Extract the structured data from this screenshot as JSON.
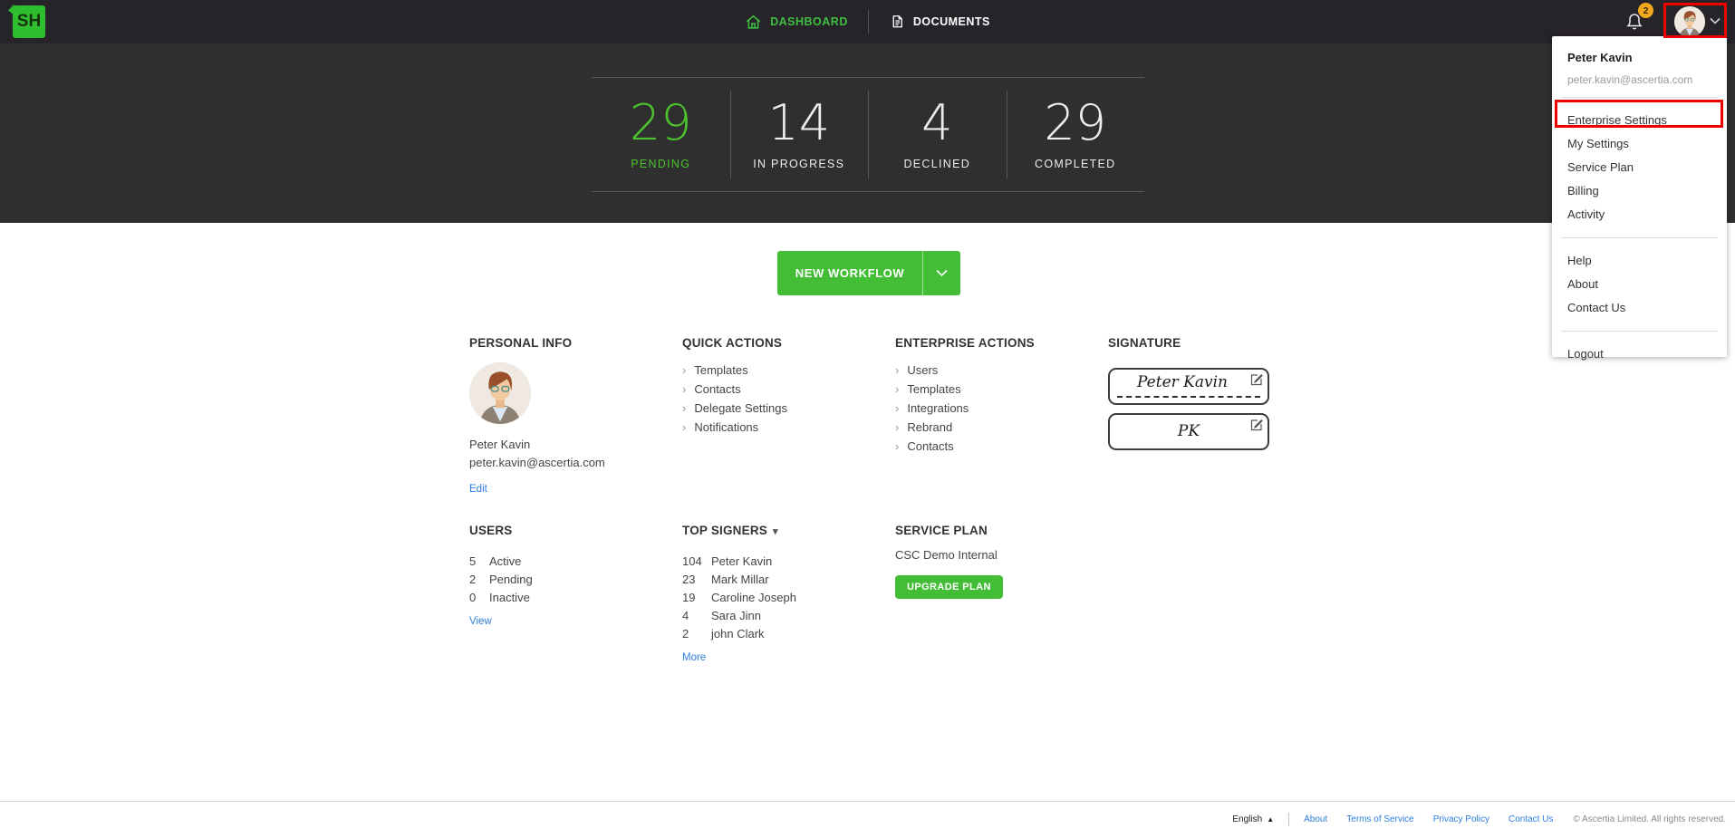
{
  "app": {
    "logo_text": "SH"
  },
  "nav": {
    "tabs": [
      {
        "label": "DASHBOARD"
      },
      {
        "label": "DOCUMENTS"
      }
    ],
    "notification_count": "2"
  },
  "stats": {
    "items": [
      {
        "value": "29",
        "label": "PENDING"
      },
      {
        "value": "14",
        "label": "IN PROGRESS"
      },
      {
        "value": "4",
        "label": "DECLINED"
      },
      {
        "value": "29",
        "label": "COMPLETED"
      }
    ]
  },
  "workflow": {
    "new_button_label": "NEW WORKFLOW"
  },
  "personal_info": {
    "heading": "PERSONAL INFO",
    "name": "Peter Kavin",
    "email": "peter.kavin@ascertia.com",
    "edit_label": "Edit"
  },
  "quick_actions": {
    "heading": "QUICK ACTIONS",
    "items": [
      "Templates",
      "Contacts",
      "Delegate Settings",
      "Notifications"
    ]
  },
  "enterprise_actions": {
    "heading": "ENTERPRISE ACTIONS",
    "items": [
      "Users",
      "Templates",
      "Integrations",
      "Rebrand",
      "Contacts"
    ]
  },
  "signature": {
    "heading": "SIGNATURE",
    "full_signature": "Peter Kavin",
    "initials": "PK"
  },
  "users": {
    "heading": "USERS",
    "rows": [
      {
        "count": "5",
        "label": "Active"
      },
      {
        "count": "2",
        "label": "Pending"
      },
      {
        "count": "0",
        "label": "Inactive"
      }
    ],
    "view_label": "View"
  },
  "top_signers": {
    "heading": "TOP SIGNERS",
    "rows": [
      {
        "count": "104",
        "name": "Peter Kavin"
      },
      {
        "count": "23",
        "name": "Mark Millar"
      },
      {
        "count": "19",
        "name": "Caroline Joseph"
      },
      {
        "count": "4",
        "name": "Sara Jinn"
      },
      {
        "count": "2",
        "name": "john Clark"
      }
    ],
    "more_label": "More"
  },
  "service_plan": {
    "heading": "SERVICE PLAN",
    "plan_name": "CSC Demo Internal",
    "upgrade_label": "UPGRADE PLAN"
  },
  "user_menu": {
    "name": "Peter Kavin",
    "email": "peter.kavin@ascertia.com",
    "group1": [
      "Enterprise Settings",
      "My Settings",
      "Service Plan",
      "Billing",
      "Activity"
    ],
    "group2": [
      "Help",
      "About",
      "Contact Us"
    ],
    "group3": [
      "Logout"
    ],
    "highlighted_item": "Enterprise Settings"
  },
  "footer": {
    "language": "English",
    "links": [
      "About",
      "Terms of Service",
      "Privacy Policy",
      "Contact Us"
    ],
    "copyright": "© Ascertia Limited. All rights reserved."
  },
  "colors": {
    "accent_green": "#43bd35",
    "logo_green": "#2fbe2f",
    "link_blue": "#2f7de1",
    "badge_amber": "#f2a71d",
    "annotation_red": "#ee0000",
    "nav_bg": "#272429",
    "hero_bg": "#2f2f2f"
  }
}
